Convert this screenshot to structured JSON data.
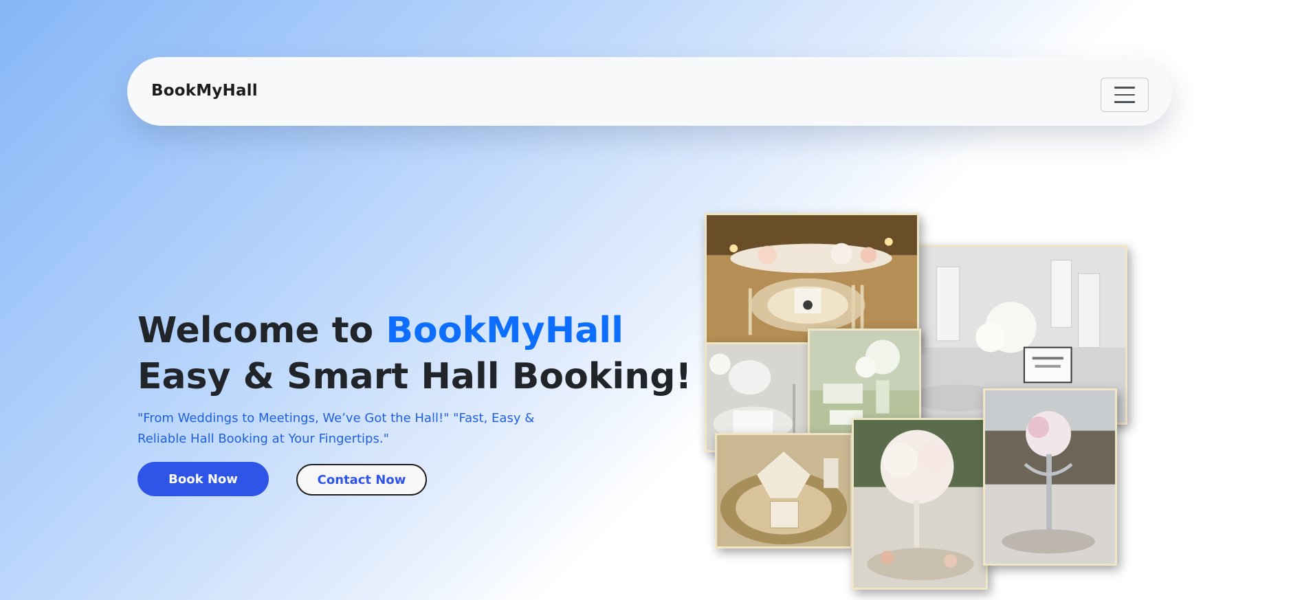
{
  "navbar": {
    "brand": "BookMyHall",
    "menu_icon": "hamburger-menu-icon"
  },
  "hero": {
    "title_prefix": "Welcome to ",
    "title_accent": "BookMyHall",
    "title_line2": "Easy & Smart Hall Booking!",
    "tagline": "\"From Weddings to Meetings, We’ve Got the Hall!\" \"Fast, Easy & Reliable Hall Booking at Your Fingertips.\"",
    "primary_button": "Book Now",
    "secondary_button": "Contact Now"
  },
  "colors": {
    "accent": "#0d6efd",
    "button_primary": "#2e54e8",
    "heading": "#212529",
    "tagline": "#1f5fe0"
  }
}
